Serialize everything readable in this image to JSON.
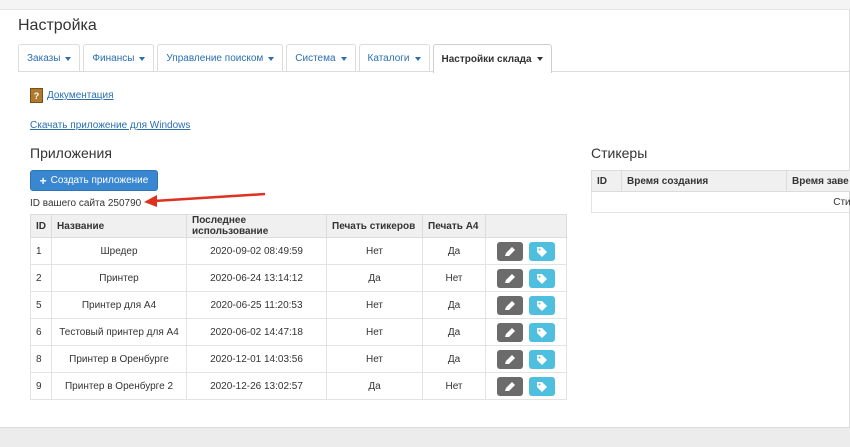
{
  "page": {
    "title": "Настройка"
  },
  "tabs": [
    {
      "label": "Заказы",
      "active": false
    },
    {
      "label": "Финансы",
      "active": false
    },
    {
      "label": "Управление поиском",
      "active": false
    },
    {
      "label": "Система",
      "active": false
    },
    {
      "label": "Каталоги",
      "active": false
    },
    {
      "label": "Настройки склада",
      "active": true
    }
  ],
  "links": {
    "docs_icon": "?",
    "docs": "Документация",
    "download": "Скачать приложение для Windows"
  },
  "apps": {
    "heading": "Приложения",
    "create_label": "Создать приложение",
    "site_id_text": "ID вашего сайта 250790",
    "columns": [
      "ID",
      "Название",
      "Последнее использование",
      "Печать стикеров",
      "Печать А4"
    ],
    "rows": [
      {
        "id": "1",
        "name": "Шредер",
        "last_used": "2020-09-02 08:49:59",
        "stickers": "Нет",
        "a4": "Да"
      },
      {
        "id": "2",
        "name": "Принтер",
        "last_used": "2020-06-24 13:14:12",
        "stickers": "Да",
        "a4": "Нет"
      },
      {
        "id": "5",
        "name": "Принтер для А4",
        "last_used": "2020-06-25 11:20:53",
        "stickers": "Нет",
        "a4": "Да"
      },
      {
        "id": "6",
        "name": "Тестовый принтер для А4",
        "last_used": "2020-06-02 14:47:18",
        "stickers": "Нет",
        "a4": "Да"
      },
      {
        "id": "8",
        "name": "Принтер в Оренбурге",
        "last_used": "2020-12-01 14:03:56",
        "stickers": "Нет",
        "a4": "Да"
      },
      {
        "id": "9",
        "name": "Принтер в Оренбурге 2",
        "last_used": "2020-12-26 13:02:57",
        "stickers": "Да",
        "a4": "Нет"
      }
    ]
  },
  "stickers": {
    "heading": "Стикеры",
    "columns": [
      "ID",
      "Время создания",
      "Время заве"
    ],
    "empty_text": "Стик"
  },
  "colors": {
    "accent": "#3a87d1",
    "edit": "#6b6b6b",
    "tag": "#4fbfe0",
    "arrow": "#e03020"
  }
}
